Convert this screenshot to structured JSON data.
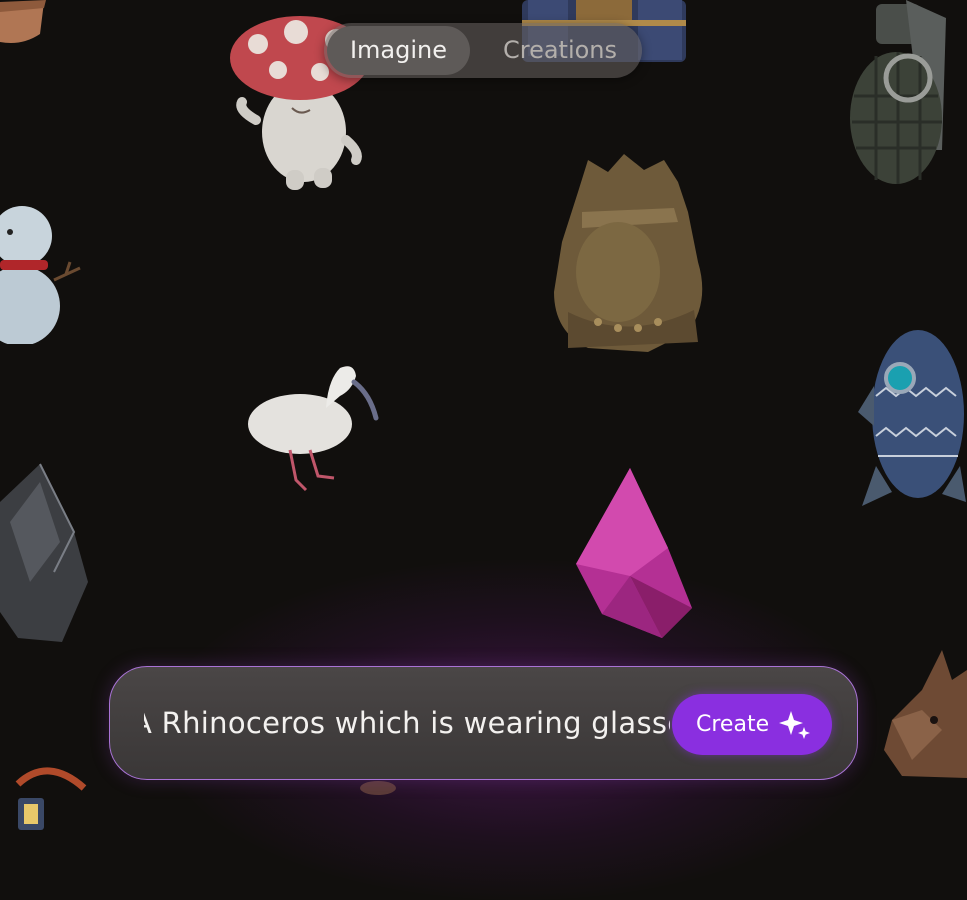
{
  "top_toggle": {
    "active_tab": "Imagine",
    "inactive_tab": "Creations"
  },
  "prompt_bar": {
    "input_value": "A Rhinoceros which is wearing glasses",
    "create_label": "Create",
    "create_icon": "sparkle-icon"
  },
  "gallery_objects": [
    "potted-plant",
    "treasure-chest",
    "mushroom-character",
    "hand-grenade",
    "snowman",
    "bronze-bust",
    "white-ibis",
    "patterned-rocket",
    "ghost-crystal",
    "magenta-crystal",
    "dragon-head",
    "lantern"
  ],
  "colors": {
    "background": "#110f0d",
    "accent": "#8a2fe0",
    "prompt_border": "#a973d6"
  }
}
